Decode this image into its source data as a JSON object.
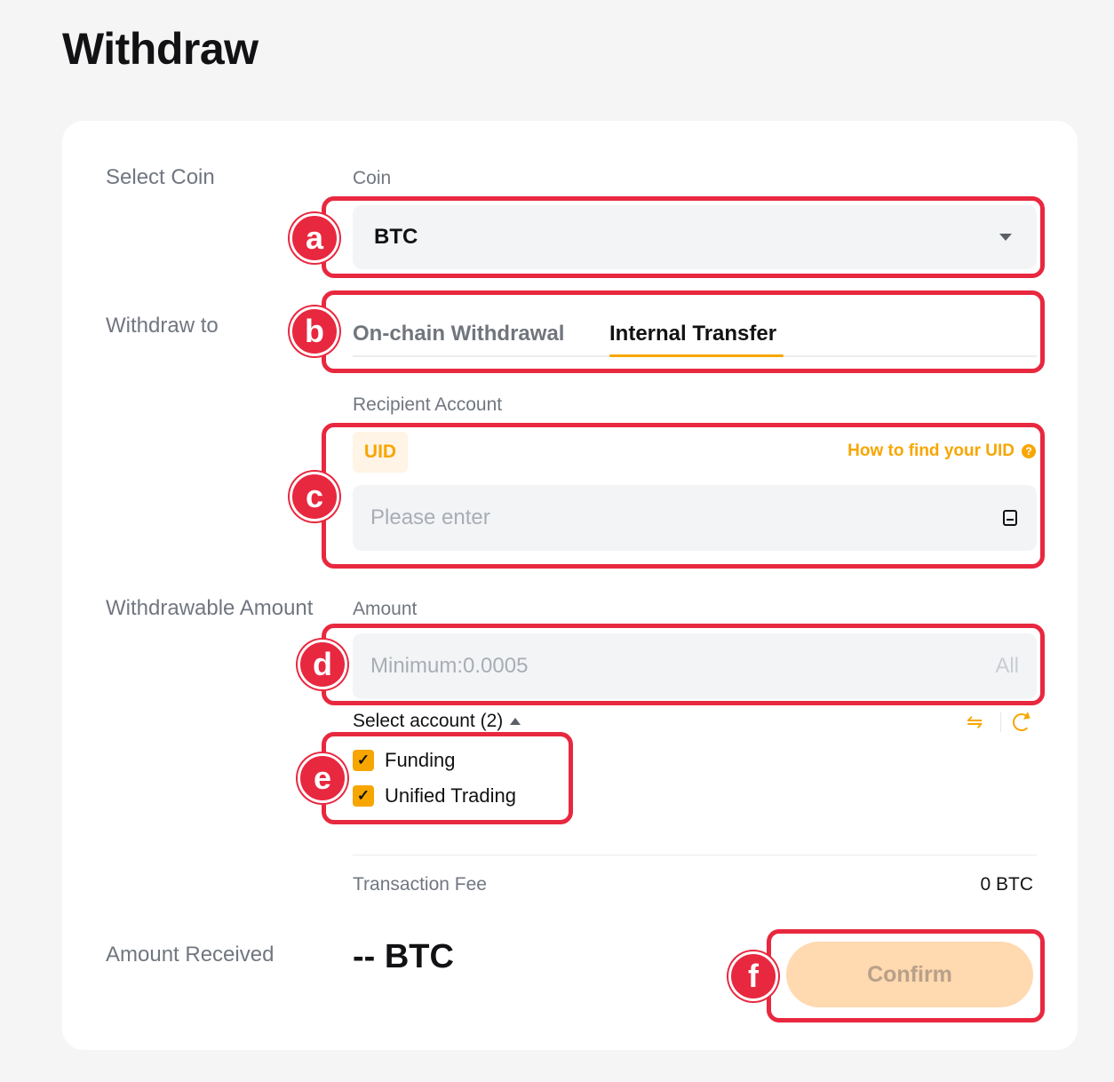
{
  "page": {
    "title": "Withdraw"
  },
  "form": {
    "select_coin_label": "Select Coin",
    "coin_field_label": "Coin",
    "coin_value": "BTC",
    "withdraw_to_label": "Withdraw to",
    "tabs": [
      {
        "label": "On-chain Withdrawal",
        "active": false
      },
      {
        "label": "Internal Transfer",
        "active": true
      }
    ],
    "recipient_label": "Recipient Account",
    "uid_chip": "UID",
    "help_link": "How to find your UID",
    "recipient_placeholder": "Please enter",
    "withdrawable_label": "Withdrawable Amount",
    "amount_label": "Amount",
    "amount_placeholder": "Minimum:0.0005",
    "all_button": "All",
    "select_account": "Select account (2)",
    "accounts": [
      {
        "label": "Funding",
        "checked": true
      },
      {
        "label": "Unified Trading",
        "checked": true
      }
    ],
    "fee_label": "Transaction Fee",
    "fee_value": "0 BTC",
    "received_label": "Amount Received",
    "received_value": "-- BTC",
    "confirm_button": "Confirm"
  },
  "annotations": {
    "markers": [
      "a",
      "b",
      "c",
      "d",
      "e",
      "f"
    ],
    "color": "#e8283f"
  },
  "colors": {
    "accent": "#f7a600",
    "button_disabled": "#ffd9b0"
  },
  "icons": {
    "coin_dropdown": "caret-down-icon",
    "help": "question-circle-icon",
    "address_book": "address-book-icon",
    "account_toggle": "caret-up-icon",
    "swap": "swap-arrows-icon",
    "refresh": "refresh-icon",
    "checkbox": "checkmark-icon"
  }
}
